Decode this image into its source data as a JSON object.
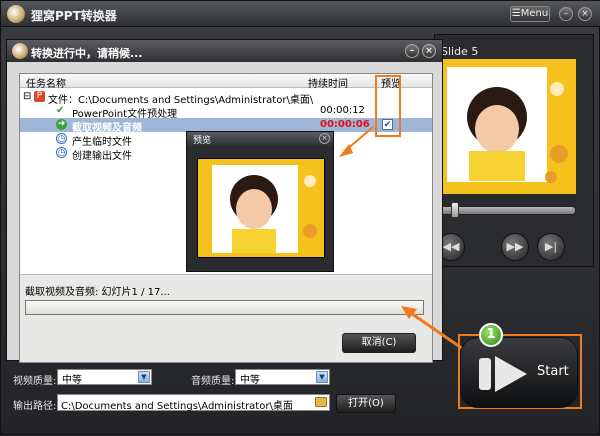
{
  "app": {
    "title": "狸窝PPT转换器",
    "menu_label": "☰Menu"
  },
  "preview": {
    "slide_label": "Slide 5"
  },
  "dialog": {
    "title": "转换进行中，请稍候...",
    "columns": {
      "task": "任务名称",
      "duration": "持续时间",
      "preview": "预览"
    },
    "rows": [
      {
        "task": "文件：C:\\Documents and Settings\\Administrator\\桌面\\",
        "duration": "",
        "preview": false
      },
      {
        "task": "PowerPoint文件预处理",
        "duration": "00:00:12",
        "preview": false
      },
      {
        "task": "截取视频及音频",
        "duration": "00:00:06",
        "preview": true
      },
      {
        "task": "产生临时文件",
        "duration": "",
        "preview": false
      },
      {
        "task": "创建输出文件",
        "duration": "",
        "preview": false
      }
    ],
    "status": "截取视频及音频: 幻灯片1 / 17...",
    "progress": 0.0,
    "cancel_label": "取消(C)"
  },
  "mini_preview": {
    "title": "预览"
  },
  "controls": {
    "video_quality_label": "视频质量:",
    "video_quality_value": "中等",
    "audio_quality_label": "音频质量:",
    "audio_quality_value": "中等",
    "output_label": "输出路径:",
    "output_path": "C:\\Documents and Settings\\Administrator\\桌面",
    "open_label": "打开(O)",
    "start_label": "Start",
    "step_badge": "1"
  },
  "colors": {
    "accent_orange": "#f07a1c",
    "selected_row": "#9fb6d8",
    "time_red": "#e01010"
  }
}
